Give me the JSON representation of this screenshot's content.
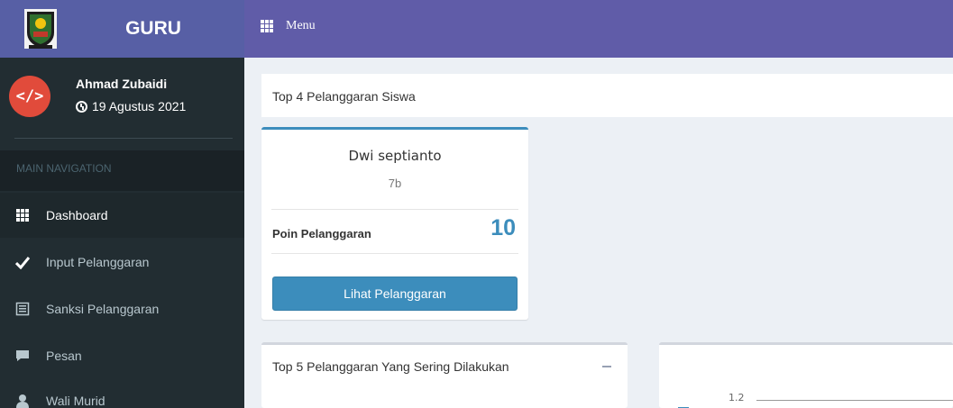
{
  "brand": {
    "title": "GURU"
  },
  "topbar": {
    "menu_label": "Menu"
  },
  "user": {
    "name": "Ahmad Zubaidi",
    "date": "19 Agustus 2021",
    "avatar_glyph": "</>",
    "avatar_color": "#e14b3b"
  },
  "sidebar": {
    "header": "MAIN NAVIGATION",
    "items": [
      {
        "label": "Dashboard",
        "icon": "grid-icon",
        "active": true
      },
      {
        "label": "Input Pelanggaran",
        "icon": "check-icon"
      },
      {
        "label": "Sanksi Pelanggaran",
        "icon": "list-icon"
      },
      {
        "label": "Pesan",
        "icon": "chat-icon"
      },
      {
        "label": "Wali Murid",
        "icon": "user-icon"
      }
    ]
  },
  "main": {
    "top_title": "Top 4 Pelanggaran Siswa",
    "card": {
      "student_name": "Dwi septianto",
      "class": "7b",
      "poin_label": "Poin Pelanggaran",
      "poin_value": "10",
      "button_label": "Lihat Pelanggaran"
    },
    "box2_title": "Top 5 Pelanggaran Yang Sering Dilakukan",
    "chart_tick": "1.2"
  },
  "colors": {
    "accent": "#3c8dbc",
    "topbar": "#605ca8",
    "sidebar": "#222d32"
  }
}
